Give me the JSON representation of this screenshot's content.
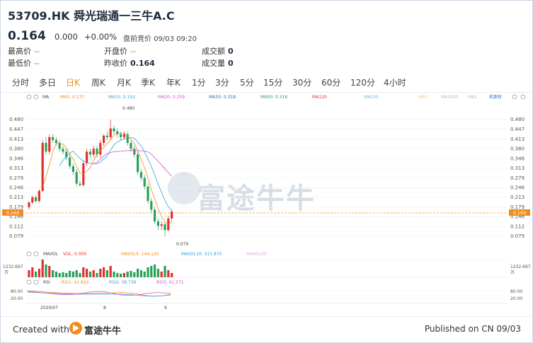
{
  "header": {
    "title": "53709.HK 舜光瑞通一三牛A.C",
    "price": "0.164",
    "change": "0.000",
    "change_pct": "+0.00%",
    "premarket": "盘前竞价 09/03 09:20",
    "stats": {
      "high_label": "最高价",
      "high": "--",
      "low_label": "最低价",
      "low": "--",
      "open_label": "开盘价",
      "open": "--",
      "prev_close_label": "昨收价",
      "prev_close": "0.164",
      "turnover_label": "成交额",
      "turnover": "0",
      "volume_label": "成交量",
      "volume": "0"
    }
  },
  "tabs": [
    "分时",
    "多日",
    "日K",
    "周K",
    "月K",
    "季K",
    "年K",
    "1分",
    "3分",
    "5分",
    "15分",
    "30分",
    "60分",
    "120分",
    "4小时"
  ],
  "active_tab": "日K",
  "legend": {
    "ma": "MA",
    "ma5": "MA5: 0.137",
    "ma10": "MA10: 0.152",
    "ma20": "MA20: 0.259",
    "ma30": "MA30: 0.318",
    "ma50": "MA50: 0.318",
    "ma120": "MA120",
    "ma250": "MA250",
    "ma3": "MA3",
    "ma1000": "MA1000",
    "ma_last": "MA1",
    "adjust": "前复权",
    "mavol": "MAVOL",
    "vol": "VOL: 0.000",
    "mavol5": "MAVOL5: 144.120",
    "mavol10": "MAVOL10: 315.870",
    "mavol20": "MAVOL20",
    "rsi": "RSI",
    "rsi1": "RSI1: 41.824",
    "rsi2": "RSI2: 38.739",
    "rsi3": "RSI3: 41.571"
  },
  "colors": {
    "up": "#e0302c",
    "down": "#2aa05a",
    "ma5": "#f08c1e",
    "ma10": "#3aa0d8",
    "ma20": "#d94fd0",
    "ma30": "#1f6fb5",
    "ma50": "#2aa05a",
    "accent": "#f08c1e"
  },
  "chart_data": {
    "type": "candlestick",
    "y_ticks": [
      "0.480",
      "0.447",
      "0.413",
      "0.380",
      "0.346",
      "0.313",
      "0.279",
      "0.246",
      "0.213",
      "0.179",
      "0.146",
      "0.112",
      "0.079"
    ],
    "current_price_tag": "0.164",
    "annot_high": "0.480",
    "annot_low": "0.079",
    "x_ticks": [
      "2020/07",
      "8",
      "9"
    ],
    "vol_tick": "1232.697",
    "vol_unit": "万",
    "rsi_ticks": [
      "80.00",
      "20.00"
    ],
    "ylim": [
      0.062,
      0.5
    ]
  },
  "watermark": "富途牛牛",
  "footer": {
    "created": "Created with",
    "brand": "富途牛牛",
    "published": "Published on CN 09/03"
  }
}
